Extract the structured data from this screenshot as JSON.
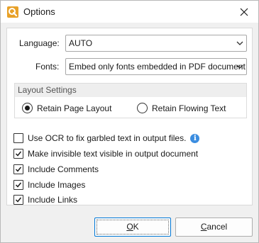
{
  "window": {
    "title": "Options"
  },
  "language": {
    "label": "Language:",
    "value": "AUTO"
  },
  "fonts": {
    "label": "Fonts:",
    "value": "Embed only fonts embedded in PDF document"
  },
  "layout_settings": {
    "title": "Layout Settings",
    "options": [
      {
        "label": "Retain Page Layout",
        "checked": true
      },
      {
        "label": "Retain Flowing Text",
        "checked": false
      }
    ]
  },
  "checkboxes": [
    {
      "label": "Use OCR to fix garbled text in output files.",
      "checked": false
    },
    {
      "label": "Make invisible text visible in output document",
      "checked": true
    },
    {
      "label": "Include Comments",
      "checked": true
    },
    {
      "label": "Include Images",
      "checked": true
    },
    {
      "label": "Include Links",
      "checked": true
    }
  ],
  "buttons": {
    "ok": "OK",
    "cancel": "Cancel"
  },
  "colors": {
    "accent": "#0078d7",
    "app_icon": "#e8a128",
    "info": "#3b8de0"
  }
}
